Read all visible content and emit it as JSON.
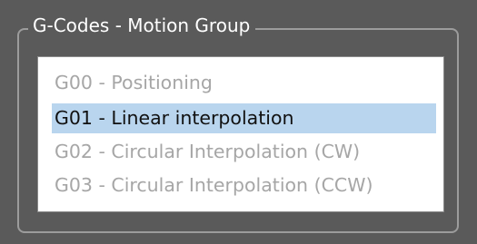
{
  "group": {
    "title": "G-Codes - Motion Group"
  },
  "list": {
    "items": [
      {
        "label": "G00 - Positioning",
        "state": "disabled"
      },
      {
        "label": "G01 - Linear interpolation",
        "state": "selected"
      },
      {
        "label": "G02 - Circular Interpolation (CW)",
        "state": "disabled"
      },
      {
        "label": "G03 - Circular Interpolation (CCW)",
        "state": "disabled"
      }
    ]
  },
  "colors": {
    "background": "#5a5a5a",
    "group_border": "#9c9c9c",
    "list_background": "#ffffff",
    "selection": "#b9d5ee",
    "disabled_text": "#a6a6a6"
  }
}
